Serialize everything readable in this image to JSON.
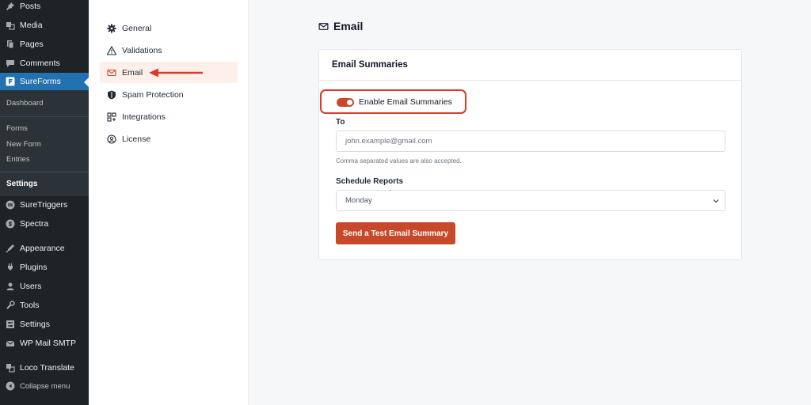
{
  "wp_menu": {
    "items": [
      {
        "label": "Posts",
        "icon": "pin-icon"
      },
      {
        "label": "Media",
        "icon": "media-icon"
      },
      {
        "label": "Pages",
        "icon": "pages-icon"
      },
      {
        "label": "Comments",
        "icon": "comments-icon"
      },
      {
        "label": "SureForms",
        "icon": "sureforms-icon"
      }
    ],
    "sureforms_sub": [
      "Dashboard",
      "Forms",
      "New Form",
      "Entries",
      "Settings"
    ],
    "lower_items": [
      {
        "label": "SureTriggers",
        "icon": "suretriggers-icon"
      },
      {
        "label": "Spectra",
        "icon": "spectra-icon"
      },
      {
        "label": "Appearance",
        "icon": "appearance-icon"
      },
      {
        "label": "Plugins",
        "icon": "plugins-icon"
      },
      {
        "label": "Users",
        "icon": "users-icon"
      },
      {
        "label": "Tools",
        "icon": "tools-icon"
      },
      {
        "label": "Settings",
        "icon": "settings-icon"
      },
      {
        "label": "WP Mail SMTP",
        "icon": "mail-smtp-icon"
      },
      {
        "label": "Loco Translate",
        "icon": "translate-icon"
      },
      {
        "label": "Collapse menu",
        "icon": "collapse-icon"
      }
    ]
  },
  "settings_nav": {
    "items": [
      {
        "label": "General",
        "icon": "gear-icon"
      },
      {
        "label": "Validations",
        "icon": "warning-icon"
      },
      {
        "label": "Email",
        "icon": "envelope-icon"
      },
      {
        "label": "Spam Protection",
        "icon": "shield-icon"
      },
      {
        "label": "Integrations",
        "icon": "integrations-icon"
      },
      {
        "label": "License",
        "icon": "license-icon"
      }
    ],
    "active": "Email"
  },
  "main": {
    "title": "Email",
    "card_title": "Email Summaries",
    "toggle_label": "Enable Email Summaries",
    "toggle_on": true,
    "to_label": "To",
    "to_value": "john.example@gmail.com",
    "to_help": "Comma separated values are also accepted.",
    "schedule_label": "Schedule Reports",
    "schedule_value": "Monday",
    "test_button": "Send a Test Email Summary"
  },
  "colors": {
    "accent": "#c7492a",
    "wp_sidebar": "#1d2327",
    "wp_active": "#2271b1",
    "annotation_red": "#d93a2b"
  }
}
